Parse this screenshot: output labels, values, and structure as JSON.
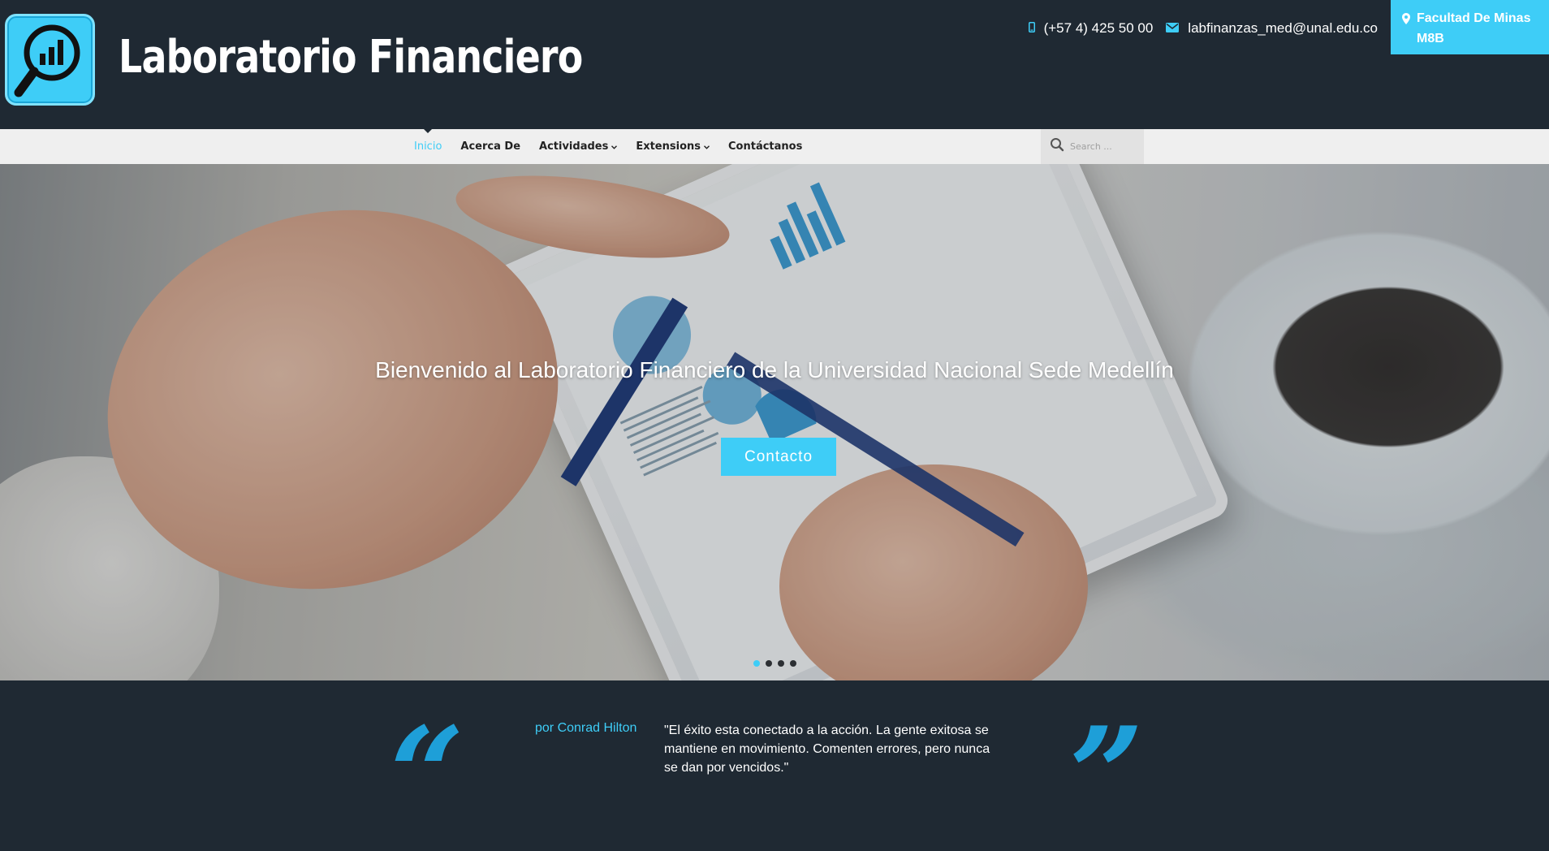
{
  "site": {
    "title": "Laboratorio Financiero",
    "logo_icon": "magnifier-chart-icon"
  },
  "contact": {
    "phone": "(+57 4) 425 50 00",
    "email": "labfinanzas_med@unal.edu.co",
    "location": "Facultad De Minas M8B"
  },
  "nav": {
    "items": [
      {
        "label": "Inicio",
        "active": true
      },
      {
        "label": "Acerca De"
      },
      {
        "label": "Actividades",
        "has_dropdown": true
      },
      {
        "label": "Extensions",
        "has_dropdown": true
      },
      {
        "label": "Contáctanos"
      }
    ],
    "search_placeholder": "Search ..."
  },
  "hero": {
    "title": "Bienvenido al Laboratorio Financiero de la Universidad Nacional Sede Medellín",
    "button_label": "Contacto",
    "slides_count": 4,
    "active_slide": 1
  },
  "quote": {
    "author": "por Conrad Hilton",
    "text": "\"El éxito esta conectado a la acción. La gente exitosa se mantiene en movimiento. Comenten errores, pero nunca se dan por vencidos.\""
  },
  "colors": {
    "accent": "#3ecdf7",
    "dark": "#1f2933",
    "quote_mark": "#1e9fd8"
  }
}
